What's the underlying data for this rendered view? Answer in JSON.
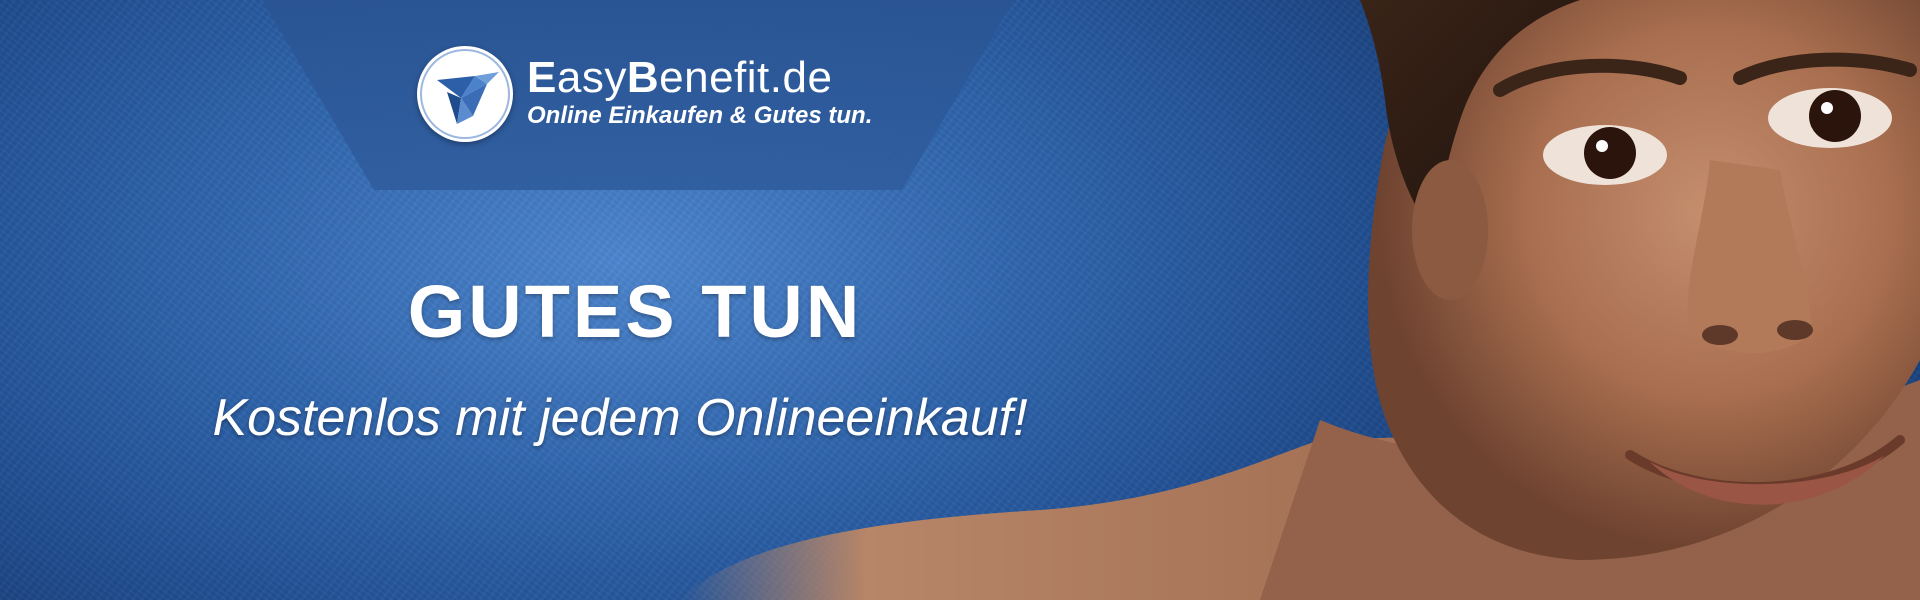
{
  "banner": {
    "brand": {
      "part1_initial": "E",
      "part1_rest": "asy",
      "part2_initial": "B",
      "part2_rest": "enefit.de",
      "tagline": "Online Einkaufen & Gutes tun."
    },
    "headline": "GUTES TUN",
    "subline": "Kostenlos mit jedem Onlineeinkauf!",
    "logo_icon": "origami-bird-icon",
    "photo": "smiling-child-photo"
  },
  "colors": {
    "background": "#2f65ad",
    "plate": "#2c5896",
    "text": "#ffffff",
    "icon_blue": "#3a6db5"
  }
}
